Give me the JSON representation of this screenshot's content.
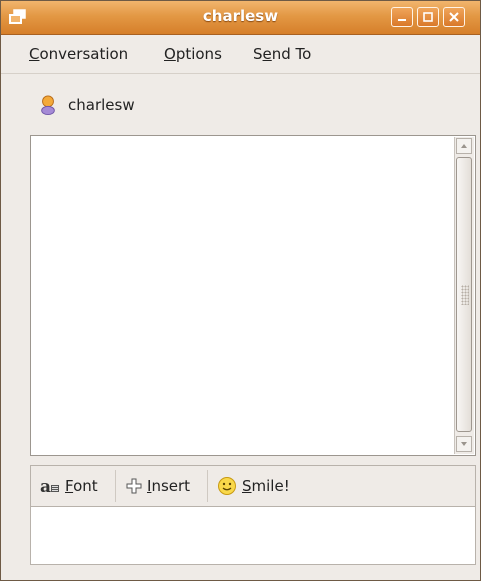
{
  "window": {
    "title": "charlesw"
  },
  "menu": {
    "items": [
      {
        "label_first": "C",
        "label_rest": "onversation"
      },
      {
        "label_first": "O",
        "label_rest": "ptions"
      },
      {
        "label_pre": "S",
        "label_u": "e",
        "label_rest": "nd To"
      }
    ]
  },
  "buddy": {
    "name": "charlesw",
    "icon": "buddy-icon"
  },
  "toolbar": {
    "font": {
      "u": "F",
      "rest": "ont",
      "icon": "font-icon"
    },
    "insert": {
      "u": "I",
      "rest": "nsert",
      "icon": "insert-icon"
    },
    "smile": {
      "u": "S",
      "rest": "mile!",
      "icon": "smiley-icon"
    }
  },
  "colors": {
    "titlebar": "#e39844",
    "window_bg": "#efebe7"
  }
}
